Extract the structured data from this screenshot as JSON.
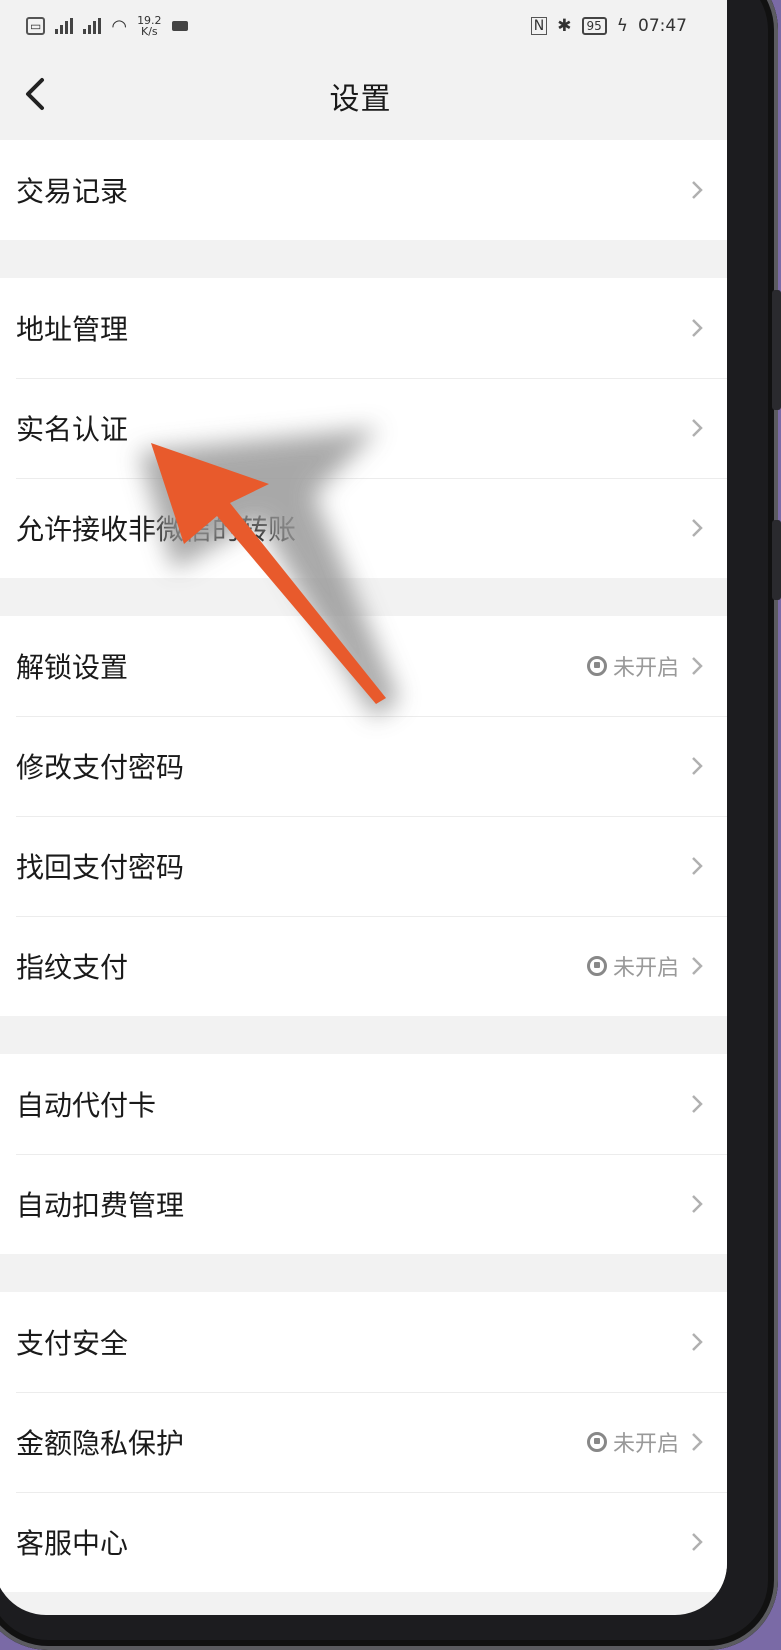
{
  "status_bar": {
    "left_icons": [
      "sim-icon",
      "signal-icon",
      "signal-icon",
      "wifi-icon"
    ],
    "speed_value": "19.2",
    "speed_unit": "K/s",
    "battery": "95",
    "time": "07:47"
  },
  "header": {
    "title": "设置"
  },
  "groups": [
    [
      {
        "label": "交易记录"
      }
    ],
    [
      {
        "label": "地址管理"
      },
      {
        "label": "实名认证"
      },
      {
        "label": "允许接收非微信的转账"
      }
    ],
    [
      {
        "label": "解锁设置",
        "status": "未开启"
      },
      {
        "label": "修改支付密码"
      },
      {
        "label": "找回支付密码"
      },
      {
        "label": "指纹支付",
        "status": "未开启"
      }
    ],
    [
      {
        "label": "自动代付卡"
      },
      {
        "label": "自动扣费管理"
      }
    ],
    [
      {
        "label": "支付安全"
      },
      {
        "label": "金额隐私保护",
        "status": "未开启"
      },
      {
        "label": "客服中心"
      }
    ]
  ],
  "colors": {
    "annotation_arrow": "#e85a2c",
    "background": "#f2f2f2"
  }
}
